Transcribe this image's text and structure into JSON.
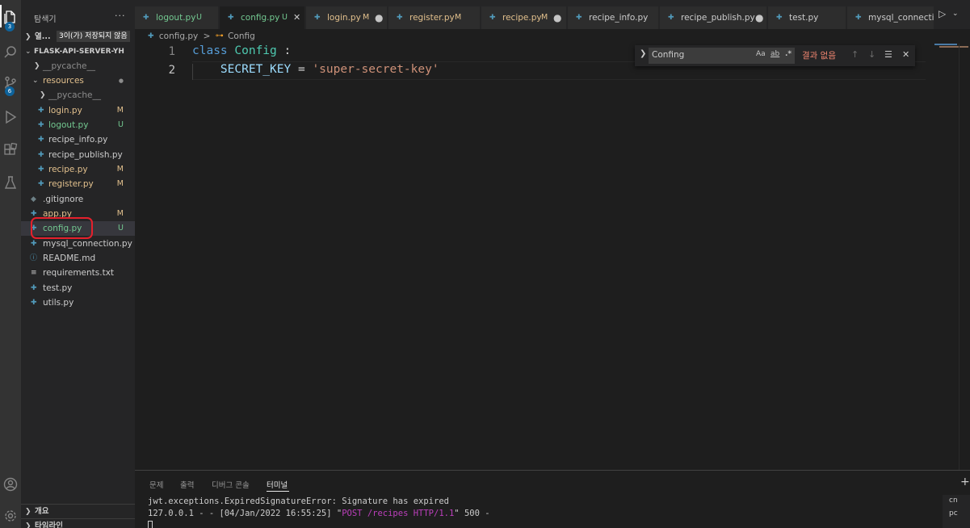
{
  "activity_bar": {
    "explorer_badge": "3",
    "scm_badge": "6"
  },
  "sidebar": {
    "title": "탐색기",
    "more": "···",
    "open_editors_label": "열...",
    "open_editors_unsaved": "3이(가) 저장되지 않음",
    "project_name": "FLASK-API-SERVER-YH",
    "files": [
      {
        "name": "__pycache__",
        "badge": ""
      },
      {
        "name": "resources",
        "badge": "●"
      },
      {
        "name": "__pycache__",
        "badge": ""
      },
      {
        "name": "login.py",
        "badge": "M"
      },
      {
        "name": "logout.py",
        "badge": "U"
      },
      {
        "name": "recipe_info.py",
        "badge": ""
      },
      {
        "name": "recipe_publish.py",
        "badge": ""
      },
      {
        "name": "recipe.py",
        "badge": "M"
      },
      {
        "name": "register.py",
        "badge": "M"
      },
      {
        "name": ".gitignore",
        "badge": ""
      },
      {
        "name": "app.py",
        "badge": "M"
      },
      {
        "name": "config.py",
        "badge": "U"
      },
      {
        "name": "mysql_connection.py",
        "badge": ""
      },
      {
        "name": "README.md",
        "badge": ""
      },
      {
        "name": "requirements.txt",
        "badge": ""
      },
      {
        "name": "test.py",
        "badge": ""
      },
      {
        "name": "utils.py",
        "badge": ""
      }
    ],
    "outline_label": "개요",
    "timeline_label": "타임라인"
  },
  "tabs": [
    {
      "name": "logout.py",
      "status": "U"
    },
    {
      "name": "config.py",
      "status": "U",
      "close": "✕"
    },
    {
      "name": "login.py",
      "status": "M",
      "dot": "●"
    },
    {
      "name": "register.py",
      "status": "M"
    },
    {
      "name": "recipe.py",
      "status": "M",
      "dot": "●"
    },
    {
      "name": "recipe_info.py",
      "status": ""
    },
    {
      "name": "recipe_publish.py",
      "status": "",
      "dot": "●"
    },
    {
      "name": "test.py",
      "status": ""
    },
    {
      "name": "mysql_connection",
      "status": ""
    }
  ],
  "breadcrumb": {
    "file": "config.py",
    "separator": ">",
    "symbol": "Config"
  },
  "editor": {
    "lines": [
      {
        "number": "1",
        "kw": "class",
        "cls": "Config",
        "rest": " :"
      },
      {
        "number": "2",
        "var": "SECRET_KEY",
        "op": " = ",
        "str": "'super-secret-key'"
      }
    ]
  },
  "find_widget": {
    "query": "Confing",
    "match_case": "Aa",
    "whole_word": "ab",
    "regex": ".*",
    "result": "결과 없음"
  },
  "panel": {
    "tabs": [
      "문제",
      "출력",
      "디버그 콘솔",
      "터미널"
    ],
    "terminal_lines": {
      "line1": "jwt.exceptions.ExpiredSignatureError: Signature has expired",
      "line2_prefix": "127.0.0.1 - - [04/Jan/2022 16:55:25] \"",
      "line2_request": "POST /recipes HTTP/1.1",
      "line2_suffix": "\" 500 -"
    },
    "terminal_list": [
      "cn",
      "pc"
    ]
  },
  "colors": {
    "modified": "#e2c08d",
    "untracked": "#73c991",
    "accent_annotation": "#e5202c"
  }
}
